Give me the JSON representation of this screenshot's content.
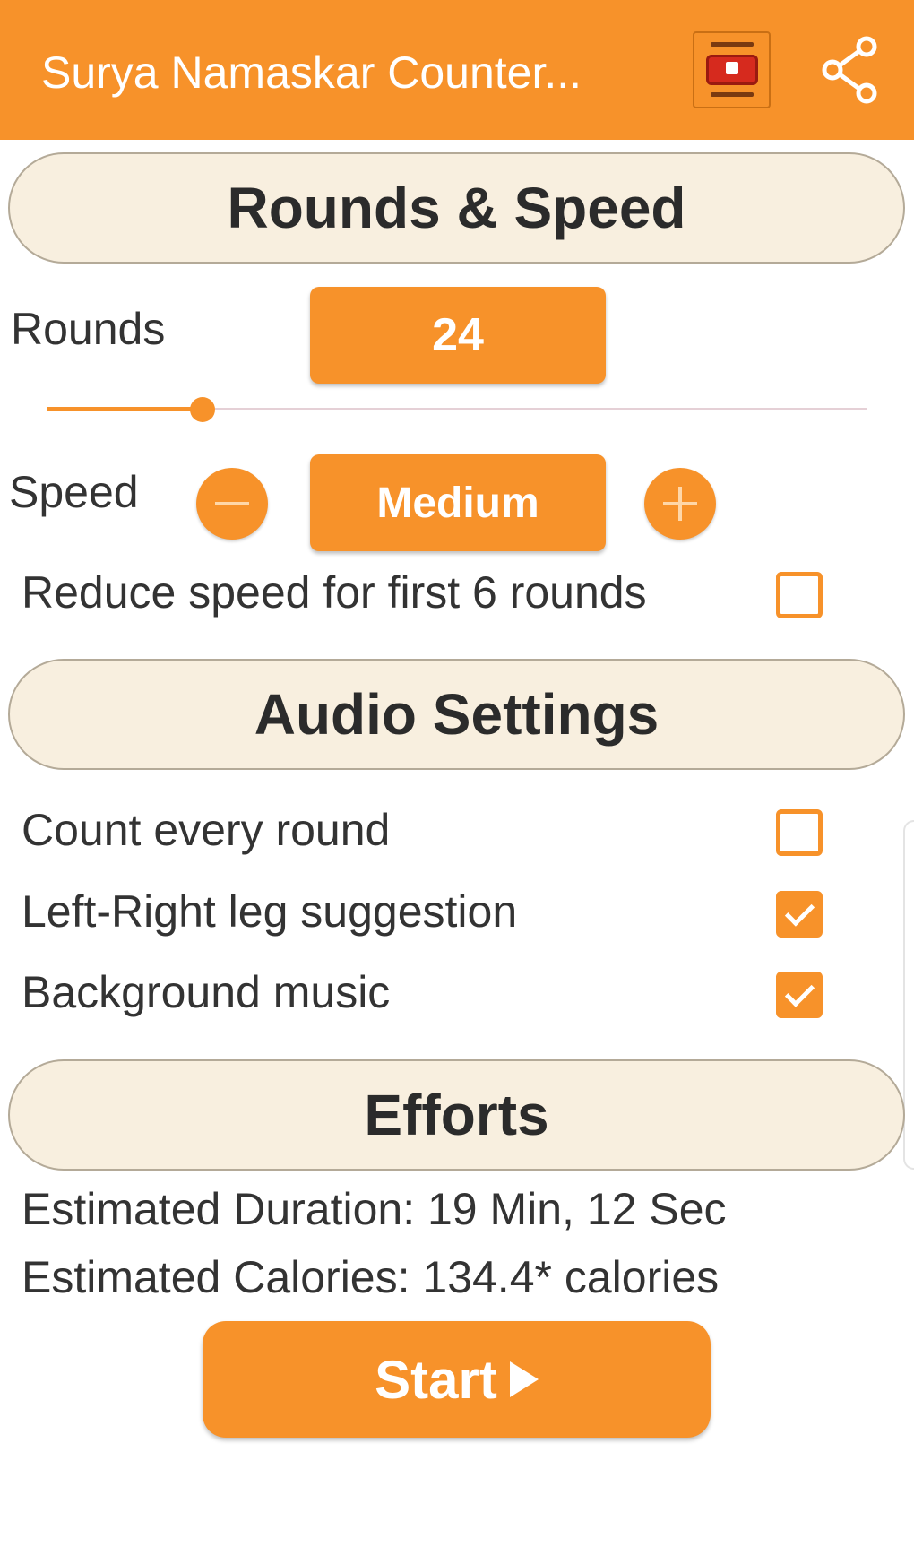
{
  "appbar": {
    "title": "Surya Namaskar Counter...",
    "ad_icon": "tv-ad-icon",
    "share_icon": "share-icon"
  },
  "sections": {
    "rounds_speed": "Rounds & Speed",
    "audio": "Audio Settings",
    "efforts": "Efforts"
  },
  "rounds": {
    "label": "Rounds",
    "value": "24",
    "slider_fraction": 0.19
  },
  "speed": {
    "label": "Speed",
    "value": "Medium",
    "decrease_icon": "minus-icon",
    "increase_icon": "plus-icon"
  },
  "options": {
    "reduce_speed": {
      "label": "Reduce speed for first 6 rounds",
      "checked": false
    },
    "count_every_round": {
      "label": "Count every round",
      "checked": false
    },
    "left_right_leg": {
      "label": "Left-Right leg suggestion",
      "checked": true
    },
    "background_music": {
      "label": "Background music",
      "checked": true
    }
  },
  "efforts": {
    "duration": "Estimated Duration: 19 Min, 12 Sec",
    "calories": "Estimated Calories: 134.4* calories"
  },
  "start_button": {
    "label": "Start",
    "icon": "play-icon"
  },
  "colors": {
    "accent": "#f7922a",
    "section_bg": "#f8efdf"
  }
}
